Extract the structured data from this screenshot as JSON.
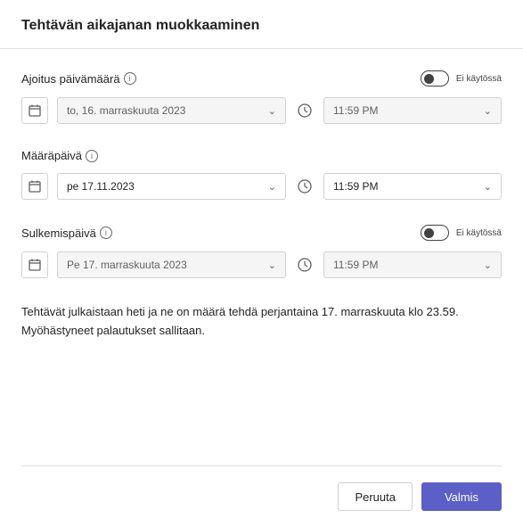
{
  "title": "Tehtävän aikajanan muokkaaminen",
  "schedule": {
    "label": "Ajoitus päivämäärä",
    "toggle_label": "Ei käytössä",
    "date": "to,    16. marraskuuta 2023",
    "time": "11:59 PM"
  },
  "due": {
    "label": "Määräpäivä",
    "date": "pe 17.11.2023",
    "time": "11:59 PM"
  },
  "close": {
    "label": "Sulkemispäivä",
    "toggle_label": "Ei käytössä",
    "date": "Pe   17. marraskuuta 2023",
    "time": "11:59 PM"
  },
  "summary": "Tehtävät julkaistaan heti ja ne on määrä tehdä perjantaina 17. marraskuuta klo 23.59. Myöhästyneet palautukset sallitaan.",
  "actions": {
    "cancel": "Peruuta",
    "done": "Valmis"
  }
}
